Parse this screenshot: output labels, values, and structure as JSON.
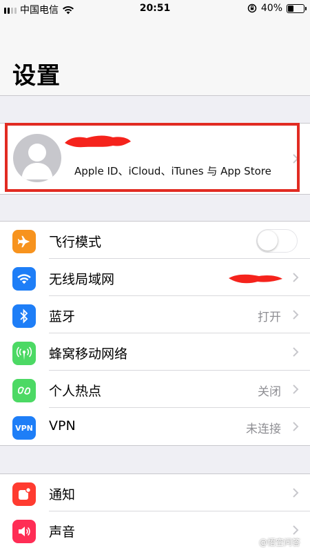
{
  "status_bar": {
    "carrier": "中国电信",
    "time": "20:51",
    "battery_percent": "40%",
    "battery_level": 0.4,
    "icons": [
      "signal-icon",
      "wifi-icon",
      "rotation-lock-icon",
      "battery-icon"
    ]
  },
  "header": {
    "title": "设置"
  },
  "profile": {
    "subtitle": "Apple ID、iCloud、iTunes 与 App Store"
  },
  "colors": {
    "airplane": "#f7931e",
    "wifi": "#1e7ef7",
    "bluetooth": "#1e7ef7",
    "cellular": "#4cd964",
    "hotspot": "#4cd964",
    "vpn": "#1e7ef7",
    "notifications": "#ff3b30",
    "sounds": "#ff2d55",
    "highlight": "#e12b22"
  },
  "network_group": {
    "airplane": {
      "label": "飞行模式",
      "icon": "airplane-icon",
      "toggle_on": false
    },
    "wifi": {
      "label": "无线局域网",
      "icon": "wifi-icon"
    },
    "bluetooth": {
      "label": "蓝牙",
      "value": "打开",
      "icon": "bluetooth-icon"
    },
    "cellular": {
      "label": "蜂窝移动网络",
      "icon": "antenna-icon"
    },
    "hotspot": {
      "label": "个人热点",
      "value": "关闭",
      "icon": "hotspot-icon"
    },
    "vpn": {
      "label": "VPN",
      "value": "未连接",
      "icon_text": "VPN"
    }
  },
  "system_group": {
    "notifications": {
      "label": "通知",
      "icon": "notification-icon"
    },
    "sounds": {
      "label": "声音",
      "icon": "speaker-icon"
    }
  },
  "watermark": {
    "text": "@悟空问答"
  }
}
